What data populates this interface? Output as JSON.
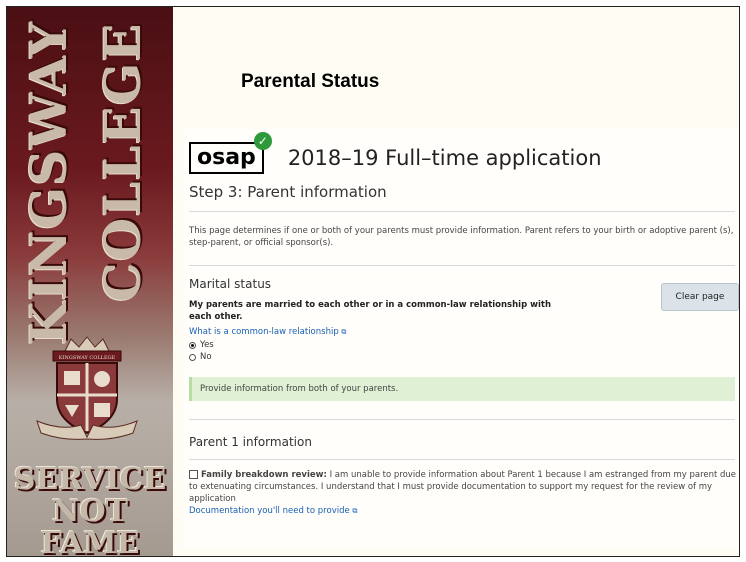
{
  "banner": {
    "vertical_line_1": "KINGSWAY",
    "vertical_line_2": "COLLEGE",
    "crest_ribbon": "KINGSWAY COLLEGE",
    "motto": [
      "SERVICE",
      "NOT",
      "FAME"
    ],
    "colors": {
      "maroon": "#6b1a1f",
      "stone": "#c4b9a8"
    }
  },
  "slide": {
    "title": "Parental Status"
  },
  "app": {
    "logo": "osap",
    "logo_badge_icon": "checkmark-circle-icon",
    "title": "2018–19 Full–time application",
    "step_title": "Step 3: Parent information",
    "intro": "This page determines if one or both of your parents must provide information. Parent refers to your birth or adoptive parent (s), step-parent, or official sponsor(s).",
    "marital": {
      "heading": "Marital status",
      "question": "My parents are married to each other or in a common-law relationship with each other.",
      "link": "What is a common-law relationship",
      "options": [
        {
          "label": "Yes",
          "selected": true
        },
        {
          "label": "No",
          "selected": false
        }
      ],
      "clear_button": "Clear page"
    },
    "info_message": "Provide information from both of your parents.",
    "parent1": {
      "heading": "Parent 1 information",
      "review_label": "Family breakdown review:",
      "review_text": " I am unable to provide information about Parent 1 because I am estranged from my parent due to extenuating circumstances. I understand that I must provide documentation to support my request for the review of my application",
      "doc_link": "Documentation you'll need to provide"
    },
    "colors": {
      "info_bg": "#dff0d4",
      "link": "#1a5fb4",
      "badge": "#2e9a3c"
    }
  }
}
